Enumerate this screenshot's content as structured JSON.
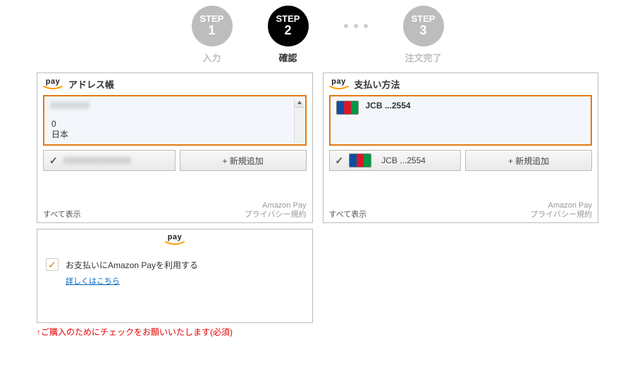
{
  "steps": {
    "s1": {
      "word": "STEP",
      "num": "1",
      "label": "入力"
    },
    "s2": {
      "word": "STEP",
      "num": "2",
      "label": "確認"
    },
    "s3": {
      "word": "STEP",
      "num": "3",
      "label": "注文完了"
    }
  },
  "address": {
    "title": "アドレス帳",
    "line_zero": "0",
    "country": "日本",
    "add_new": "+ 新規追加",
    "show_all": "すべて表示",
    "amazon_pay": "Amazon Pay",
    "privacy": "プライバシー規約"
  },
  "payment": {
    "title": "支払い方法",
    "card_label": "JCB ...2554",
    "add_new": "+ 新規追加",
    "show_all": "すべて表示",
    "amazon_pay": "Amazon Pay",
    "privacy": "プライバシー規約"
  },
  "consent": {
    "pay_word": "pay",
    "text": "お支払いにAmazon Payを利用する",
    "link": "詳しくはこちら"
  },
  "warning": "↑ご購入のためにチェックをお願いいたします(必須)"
}
